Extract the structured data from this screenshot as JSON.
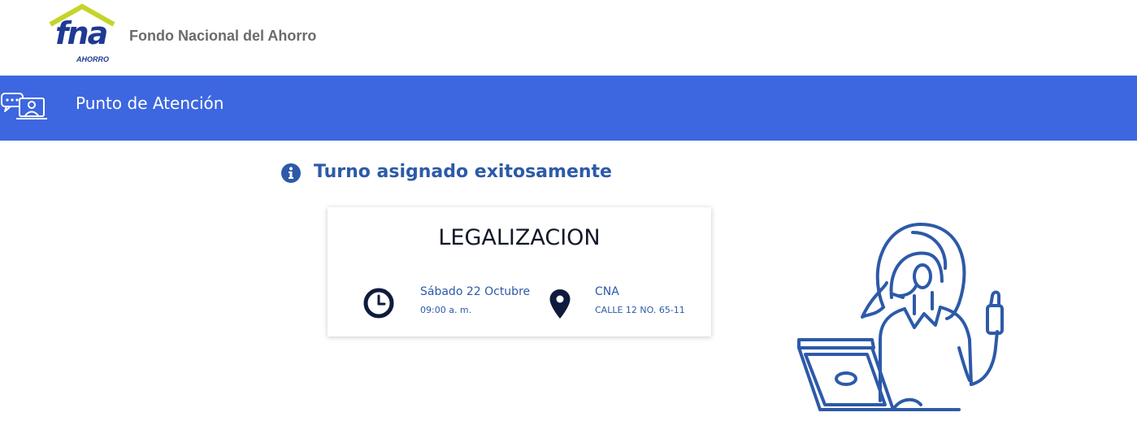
{
  "header": {
    "logo_text": "fna",
    "logo_subtext": "AHORRO",
    "org_name": "Fondo Nacional del Ahorro"
  },
  "bar": {
    "icon": "video-chat-icon",
    "title": "Punto de Atención"
  },
  "message": {
    "icon": "info-icon",
    "text": "Turno asignado exitosamente"
  },
  "card": {
    "title": "LEGALIZACION",
    "date_icon": "clock-icon",
    "date": "Sábado 22 Octubre",
    "time": "09:00 a. m.",
    "place_icon": "map-pin-icon",
    "place": "CNA",
    "address": "CALLE 12 NO. 65-11"
  },
  "illustration": {
    "icon": "support-agent-illustration"
  },
  "colors": {
    "bar": "#3d67e0",
    "brand_blue": "#1f3a93",
    "text_blue": "#2d5aa8",
    "logo_roof": "#c5d42a",
    "dark_navy": "#0f1b3d"
  }
}
